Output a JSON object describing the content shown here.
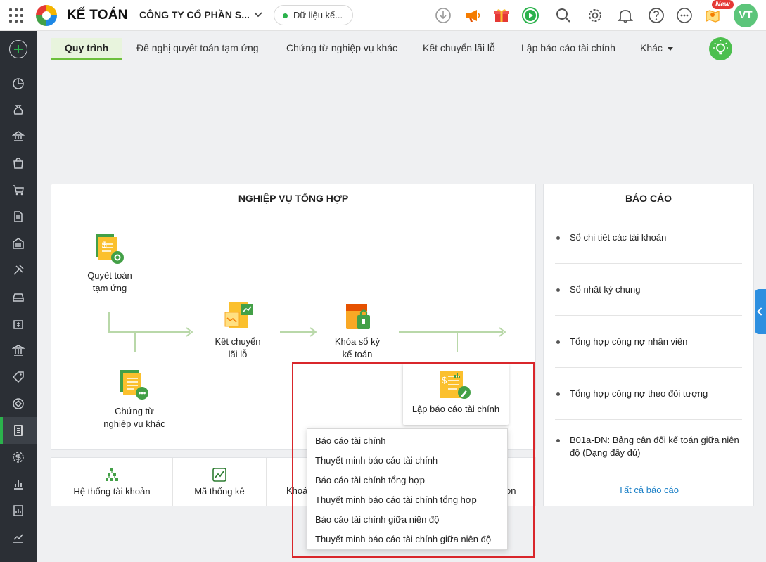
{
  "header": {
    "app_name": "KẾ TOÁN",
    "company": "CÔNG TY CỔ PHẦN S...",
    "data_label": "Dữ liệu kế...",
    "new_badge": "New",
    "avatar_initials": "VT"
  },
  "tabs": [
    {
      "label": "Quy trình",
      "active": true
    },
    {
      "label": "Đề nghị quyết toán tạm ứng"
    },
    {
      "label": "Chứng từ nghiệp vụ khác"
    },
    {
      "label": "Kết chuyển lãi lỗ"
    },
    {
      "label": "Lập báo cáo tài chính"
    },
    {
      "label": "Khác"
    }
  ],
  "workflow": {
    "title": "NGHIỆP VỤ TỔNG HỢP",
    "nodes": {
      "quyet_toan": "Quyết toán\ntạm ứng",
      "ket_chuyen": "Kết chuyển\nlãi lỗ",
      "khoa_so": "Khóa sổ kỳ\nkế toán",
      "chung_tu": "Chứng từ\nnghiệp vụ khác",
      "lap_bao_cao": "Lập báo cáo tài chính"
    }
  },
  "reports": {
    "title": "BÁO CÁO",
    "items": [
      "Sổ chi tiết các tài khoản",
      "Sổ nhật ký chung",
      "Tổng hợp công nợ nhân viên",
      "Tổng hợp công nợ theo đối tượng",
      "B01a-DN: Bảng cân đối kế toán giữa niên độ (Dạng đầy đủ)"
    ],
    "all_link": "Tất cả báo cáo"
  },
  "quick_links": [
    {
      "label": "Hệ thống tài khoản",
      "icon": "account-tree-icon"
    },
    {
      "label": "Mã thống kê",
      "icon": "chart-line-icon"
    },
    {
      "label": "Khoả",
      "icon": ""
    },
    {
      "label": "on",
      "icon": ""
    }
  ],
  "dropdown_items": [
    "Báo cáo tài chính",
    "Thuyết minh báo cáo tài chính",
    "Báo cáo tài chính tổng hợp",
    "Thuyết minh báo cáo tài chính tổng hợp",
    "Báo cáo tài chính giữa niên độ",
    "Thuyết minh báo cáo tài chính giữa niên độ"
  ],
  "colors": {
    "accent_green": "#2bb24c",
    "sidebar": "#2b2f35",
    "highlight_red": "#d9262b",
    "link_blue": "#1a7fc6"
  }
}
